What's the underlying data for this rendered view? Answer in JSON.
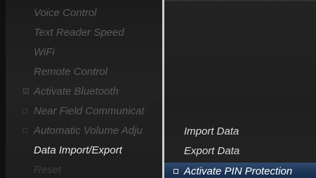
{
  "menu": {
    "items": [
      {
        "label": "Voice Control",
        "mark": ""
      },
      {
        "label": "Text Reader Speed",
        "mark": ""
      },
      {
        "label": "WiFi",
        "mark": ""
      },
      {
        "label": "Remote Control",
        "mark": ""
      },
      {
        "label": "Activate Bluetooth",
        "mark": "☑"
      },
      {
        "label": "Near Field Communicat",
        "mark": "□"
      },
      {
        "label": "Automatic Volume Adju",
        "mark": "□"
      },
      {
        "label": "Data Import/Export",
        "mark": ""
      },
      {
        "label": "Reset",
        "mark": ""
      }
    ],
    "active_index": 7
  },
  "submenu": {
    "items": [
      {
        "label": "Import Data"
      },
      {
        "label": "Export Data"
      },
      {
        "label": "Activate PIN Protection"
      }
    ],
    "highlight_index": 2
  },
  "colors": {
    "background": "#1a1a1a",
    "highlight": "#1c3556",
    "active_text": "#e6e6e6",
    "inactive_text": "#5a5a5a"
  }
}
